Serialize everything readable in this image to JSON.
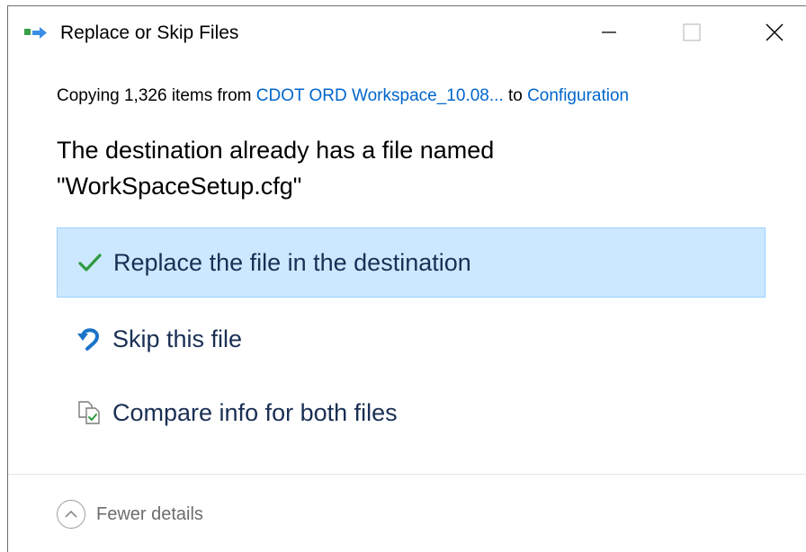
{
  "window": {
    "title": "Replace or Skip Files"
  },
  "copy_info": {
    "prefix": "Copying 1,326 items from ",
    "source": "CDOT ORD Workspace_10.08...",
    "middle": " to ",
    "destination": "Configuration"
  },
  "headline": {
    "line1": "The destination already has a file named",
    "line2": "\"WorkSpaceSetup.cfg\""
  },
  "options": [
    {
      "label": "Replace the file in the destination",
      "icon": "checkmark-icon",
      "selected": true
    },
    {
      "label": "Skip this file",
      "icon": "skip-arrow-icon",
      "selected": false
    },
    {
      "label": "Compare info for both files",
      "icon": "compare-files-icon",
      "selected": false
    }
  ],
  "footer": {
    "toggle_label": "Fewer details",
    "toggle_icon": "chevron-up-icon"
  },
  "colors": {
    "link": "#0066cc",
    "selected_bg": "#cce8ff",
    "selected_border": "#99d1ff",
    "check_green": "#2e9a40",
    "skip_blue": "#1a73c9",
    "option_text": "#1a2f54"
  }
}
